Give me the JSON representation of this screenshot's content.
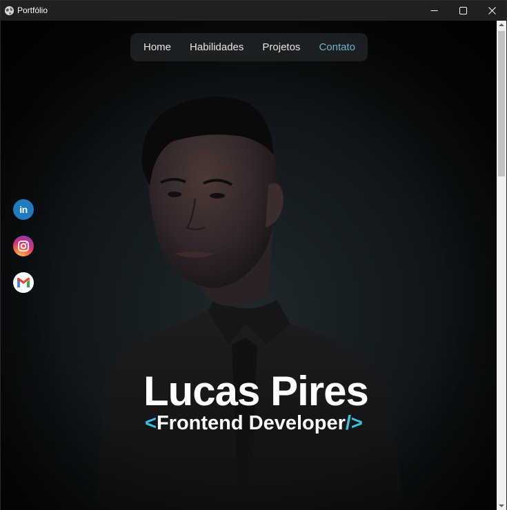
{
  "window": {
    "title": "Portfólio",
    "icon": "globe-icon",
    "controls": [
      "minimize-icon",
      "maximize-icon",
      "close-icon"
    ]
  },
  "nav": {
    "items": [
      {
        "label": "Home",
        "active": false
      },
      {
        "label": "Habilidades",
        "active": false
      },
      {
        "label": "Projetos",
        "active": false
      },
      {
        "label": "Contato",
        "active": true
      }
    ]
  },
  "social": [
    {
      "name": "linkedin-icon",
      "label": "in",
      "color": "#1f7bbd"
    },
    {
      "name": "instagram-icon",
      "color": "#d43377"
    },
    {
      "name": "gmail-icon",
      "color": "#ffffff"
    }
  ],
  "hero": {
    "name": "Lucas Pires",
    "role_open": "<",
    "role": "Frontend Developer",
    "role_close": "/>"
  },
  "colors": {
    "accent": "#3cc2e0",
    "nav_active": "#6fb7c4",
    "background": "#0b0d0e"
  }
}
